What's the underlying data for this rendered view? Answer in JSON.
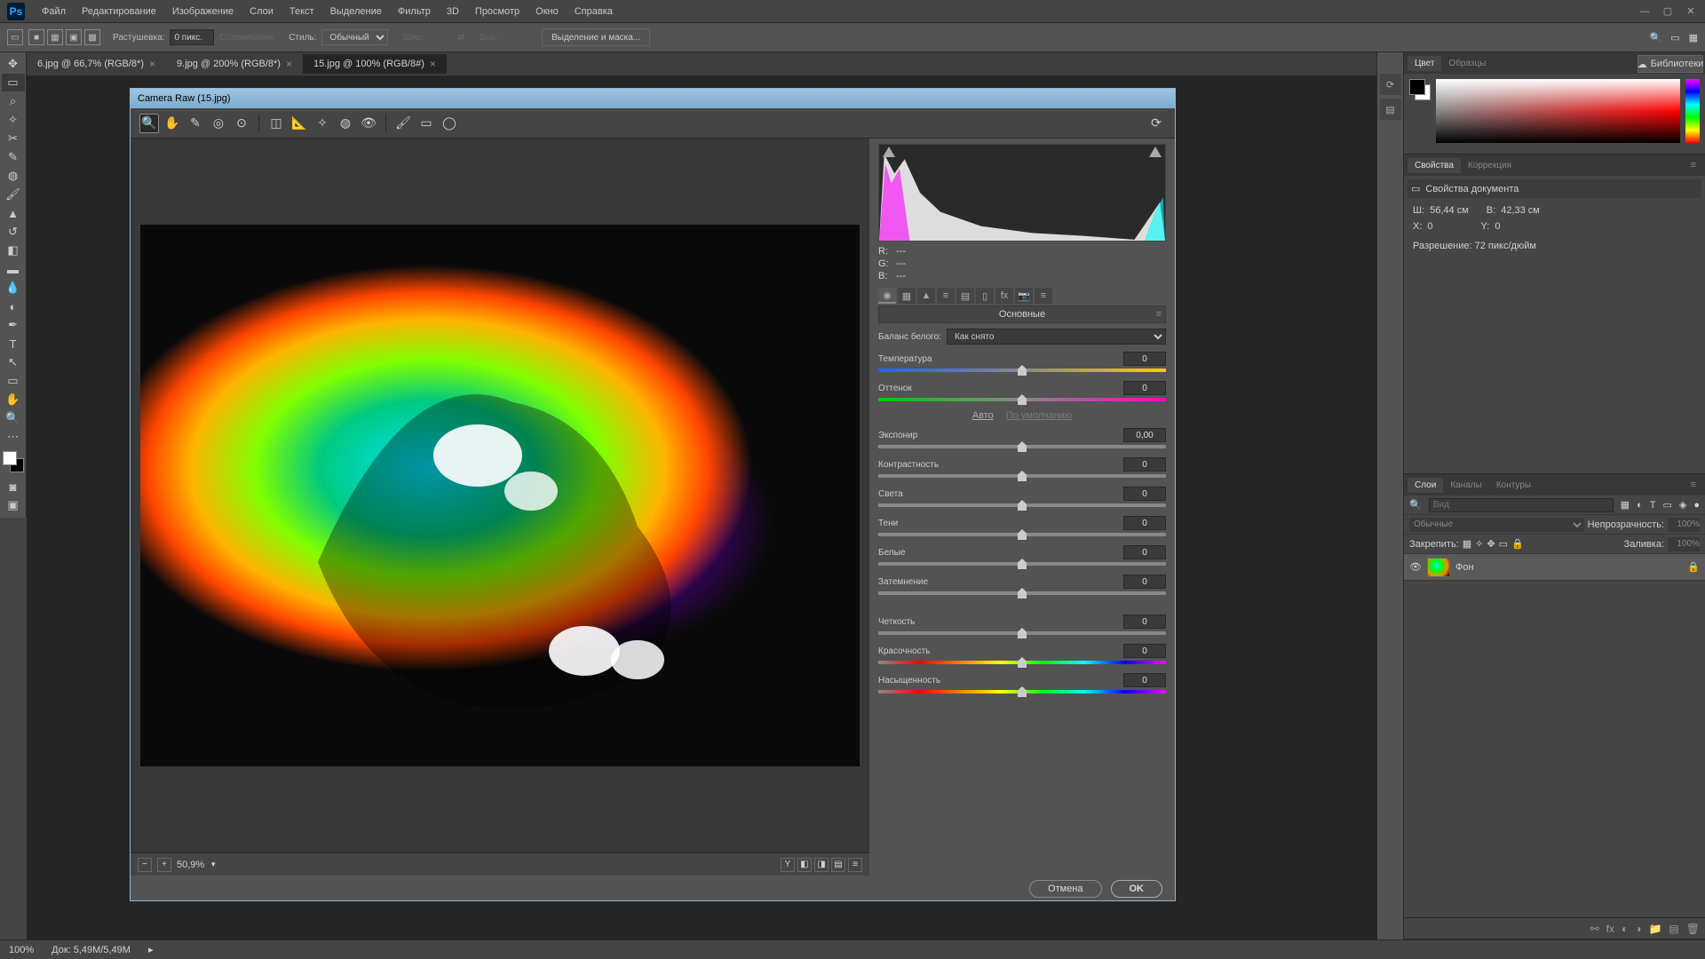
{
  "menu": [
    "Файл",
    "Редактирование",
    "Изображение",
    "Слои",
    "Текст",
    "Выделение",
    "Фильтр",
    "3D",
    "Просмотр",
    "Окно",
    "Справка"
  ],
  "options": {
    "feather_label": "Растушевка:",
    "feather_value": "0 пикс.",
    "antialias": "Сглаживание",
    "style_label": "Стиль:",
    "style_value": "Обычный",
    "width_label": "Шир.:",
    "height_label": "Выс.:",
    "select_mask": "Выделение и маска..."
  },
  "tabs": [
    {
      "label": "6.jpg @ 66,7% (RGB/8*)",
      "active": false
    },
    {
      "label": "9.jpg @ 200% (RGB/8*)",
      "active": false
    },
    {
      "label": "15.jpg @ 100% (RGB/8#)",
      "active": true
    }
  ],
  "panels": {
    "color_tab": "Цвет",
    "swatches_tab": "Образцы",
    "libraries": "Библиотеки",
    "props_tab": "Свойства",
    "adjust_tab": "Коррекция",
    "props_title": "Свойства документа",
    "w_label": "Ш:",
    "w_val": "56,44 см",
    "h_label": "В:",
    "h_val": "42,33 см",
    "x_label": "X:",
    "x_val": "0",
    "y_label": "Y:",
    "y_val": "0",
    "res": "Разрешение: 72 пикс/дюйм",
    "layers_tab": "Слои",
    "channels_tab": "Каналы",
    "paths_tab": "Контуры",
    "search_ph": "Вид",
    "blend": "Обычные",
    "opacity_label": "Непрозрачность:",
    "opacity_val": "100%",
    "lock_label": "Закрепить:",
    "fill_label": "Заливка:",
    "fill_val": "100%",
    "layer_name": "Фон"
  },
  "status": {
    "zoom": "100%",
    "doc": "Док: 5,49М/5,49М"
  },
  "cr": {
    "title": "Camera Raw (15.jpg)",
    "zoom": "50,9%",
    "rgb_r": "R:",
    "rgb_g": "G:",
    "rgb_b": "B:",
    "rgb_na": "---",
    "section": "Основные",
    "wb_label": "Баланс белого:",
    "wb_value": "Как снято",
    "sliders": [
      {
        "label": "Температура",
        "value": "0",
        "cls": "temp"
      },
      {
        "label": "Оттенок",
        "value": "0",
        "cls": "tint"
      }
    ],
    "auto": "Авто",
    "default": "По умолчанию",
    "sliders2": [
      {
        "label": "Экспонир",
        "value": "0,00"
      },
      {
        "label": "Контрастность",
        "value": "0"
      },
      {
        "label": "Света",
        "value": "0"
      },
      {
        "label": "Тени",
        "value": "0"
      },
      {
        "label": "Белые",
        "value": "0"
      },
      {
        "label": "Затемнение",
        "value": "0"
      }
    ],
    "sliders3": [
      {
        "label": "Четкость",
        "value": "0"
      },
      {
        "label": "Красочность",
        "value": "0",
        "cls": "vibr"
      },
      {
        "label": "Насыщенность",
        "value": "0",
        "cls": "vibr"
      }
    ],
    "cancel": "Отмена",
    "ok": "OK"
  }
}
